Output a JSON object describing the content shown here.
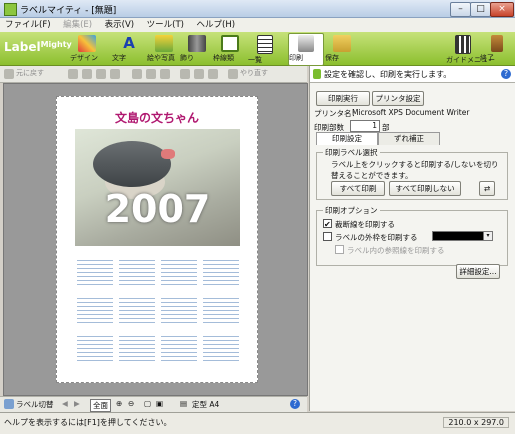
{
  "window": {
    "title": "ラベルマイティ - [無題]"
  },
  "menu": [
    "ファイル(F)",
    "編集(E)",
    "表示(V)",
    "ツール(T)",
    "ヘルプ(H)"
  ],
  "ribbon": {
    "logo": "Label",
    "logo_small": "Mighty",
    "buttons": [
      "デザイン",
      "文字",
      "絵や写真",
      "飾り",
      "枠線類",
      "一覧",
      "印刷",
      "保存"
    ],
    "right_buttons": [
      "ガイドメニュー",
      "終了"
    ]
  },
  "toolbar2": {
    "items": [
      "元に戻す",
      "やり直す"
    ]
  },
  "preview": {
    "label_title": "文島の文ちゃん",
    "year": "2007"
  },
  "bottom_toolbar": {
    "label_list": "ラベル切替",
    "zoom_mode": "全面",
    "paper": "定型 A4"
  },
  "panel": {
    "header": "設定を確認し、印刷を実行します。",
    "print_button": "印刷実行",
    "printer_settings_button": "プリンタ設定",
    "printer_label": "プリンタ名：",
    "printer_name": "Microsoft XPS Document Writer",
    "copies_label": "印刷部数",
    "copies_value": "1",
    "copies_unit": "部",
    "tabs": [
      "印刷設定",
      "ずれ補正"
    ],
    "select_section": "印刷ラベル選択",
    "select_hint": "ラベル上をクリックすると印刷する/しないを切り替えることができます。",
    "print_all": "すべて印刷",
    "print_none": "すべて印刷しない",
    "options_section": "印刷オプション",
    "opt_fill": "裁断線を印刷する",
    "opt_outline": "ラベルの外枠を印刷する",
    "opt_outline_color": "#000000",
    "opt_ref": "ラベル内の参照線を印刷する",
    "detail_button": "詳細設定..."
  },
  "status": {
    "message": "ヘルプを表示するには[F1]を押してください。",
    "paper_size": "210.0 x 297.0"
  }
}
